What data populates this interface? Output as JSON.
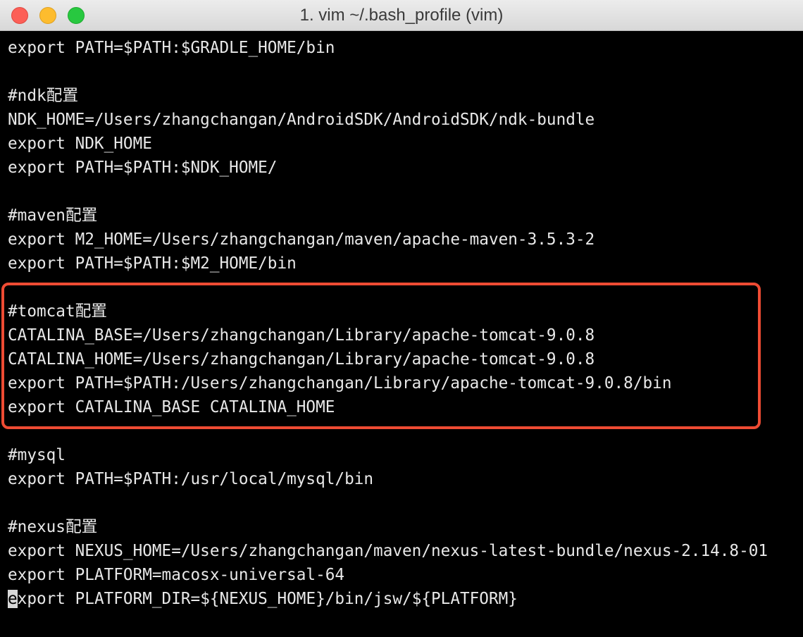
{
  "window": {
    "title": "1. vim ~/.bash_profile (vim)"
  },
  "editor": {
    "lines": [
      "export PATH=$PATH:$GRADLE_HOME/bin",
      "",
      "#ndk配置",
      "NDK_HOME=/Users/zhangchangan/AndroidSDK/AndroidSDK/ndk-bundle",
      "export NDK_HOME",
      "export PATH=$PATH:$NDK_HOME/",
      "",
      "#maven配置",
      "export M2_HOME=/Users/zhangchangan/maven/apache-maven-3.5.3-2",
      "export PATH=$PATH:$M2_HOME/bin",
      "",
      "#tomcat配置",
      "CATALINA_BASE=/Users/zhangchangan/Library/apache-tomcat-9.0.8",
      "CATALINA_HOME=/Users/zhangchangan/Library/apache-tomcat-9.0.8",
      "export PATH=$PATH:/Users/zhangchangan/Library/apache-tomcat-9.0.8/bin",
      "export CATALINA_BASE CATALINA_HOME",
      "",
      "#mysql",
      "export PATH=$PATH:/usr/local/mysql/bin",
      "",
      "#nexus配置",
      "export NEXUS_HOME=/Users/zhangchangan/maven/nexus-latest-bundle/nexus-2.14.8-01",
      "export PLATFORM=macosx-universal-64"
    ],
    "cursor_line": {
      "cursor_char": "e",
      "rest": "xport PLATFORM_DIR=${NEXUS_HOME}/bin/jsw/${PLATFORM}"
    }
  },
  "colors": {
    "background": "#000000",
    "text": "#e8e8e8",
    "highlight_border": "#ee4b33"
  }
}
